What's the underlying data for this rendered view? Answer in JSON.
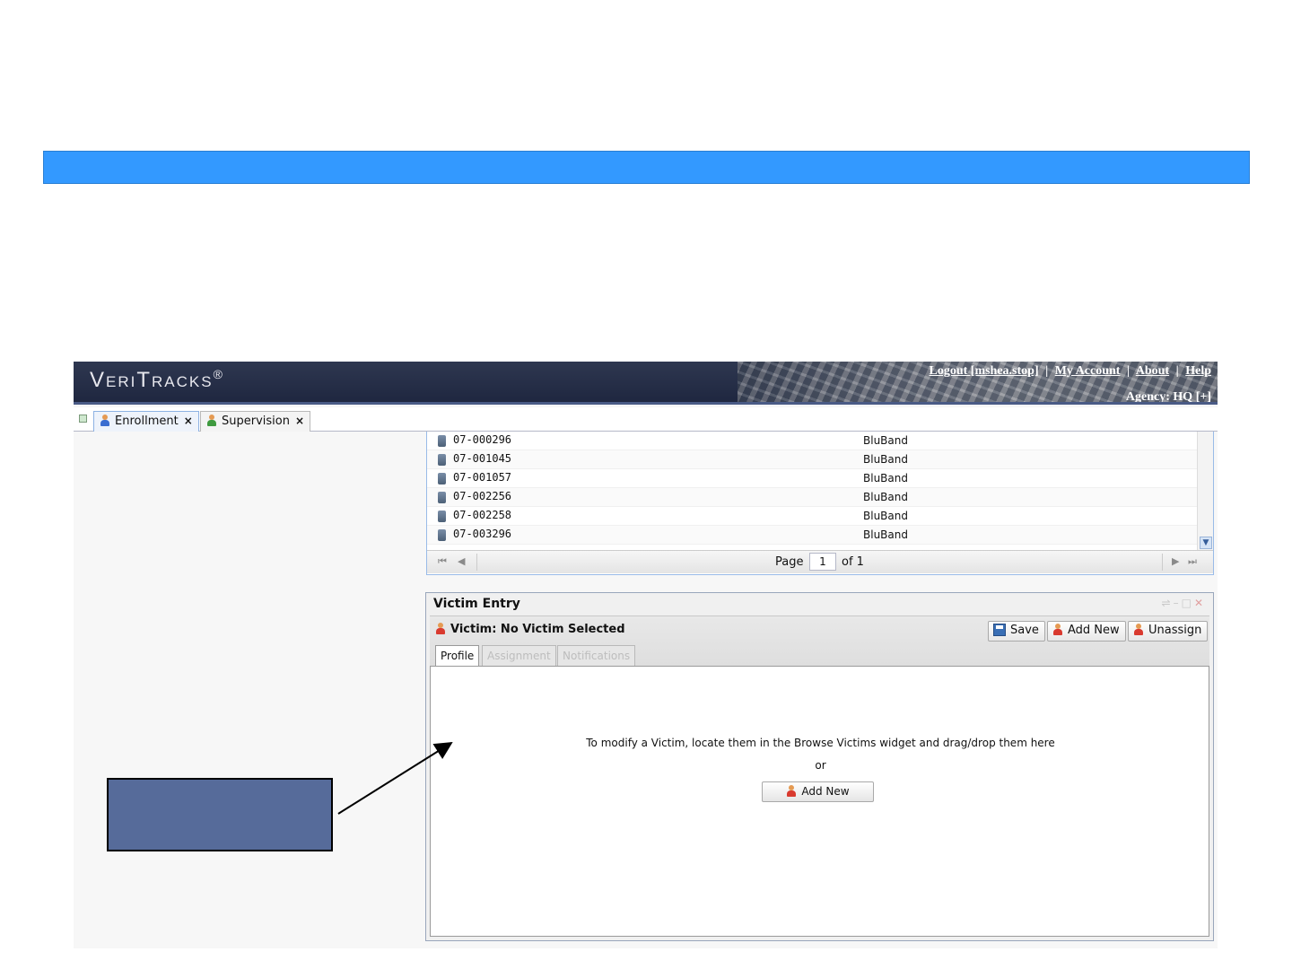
{
  "app": {
    "logo": "VeriTracks",
    "logo_mark": "®",
    "links": {
      "logout": "Logout [mshea.stop]",
      "my_account": "My Account",
      "about": "About",
      "help": "Help",
      "separator": "|"
    },
    "agency": "Agency: HQ [+]"
  },
  "tabs": [
    {
      "label": "Enrollment",
      "close": "×"
    },
    {
      "label": "Supervision",
      "close": "×"
    }
  ],
  "devices": {
    "rows": [
      {
        "id": "07-000296",
        "type": "BluBand"
      },
      {
        "id": "07-001045",
        "type": "BluBand"
      },
      {
        "id": "07-001057",
        "type": "BluBand"
      },
      {
        "id": "07-002256",
        "type": "BluBand"
      },
      {
        "id": "07-002258",
        "type": "BluBand"
      },
      {
        "id": "07-003296",
        "type": "BluBand"
      }
    ],
    "pager": {
      "first": "⏮",
      "prev": "◀",
      "page_label": "Page",
      "page_value": "1",
      "of_label": "of 1",
      "next": "▶",
      "last": "⏭"
    }
  },
  "victim_entry": {
    "title": "Victim Entry",
    "victim_label": "Victim: No Victim Selected",
    "buttons": {
      "save": "Save",
      "add_new": "Add New",
      "unassign": "Unassign"
    },
    "subtabs": [
      "Profile",
      "Assignment",
      "Notifications"
    ],
    "message": "To modify a Victim, locate them in the Browse Victims widget and drag/drop them here",
    "or": "or",
    "add_new_center": "Add New"
  },
  "colors": {
    "banner": "#3399ff",
    "header": "#1f2740",
    "callout": "#566b9a"
  }
}
